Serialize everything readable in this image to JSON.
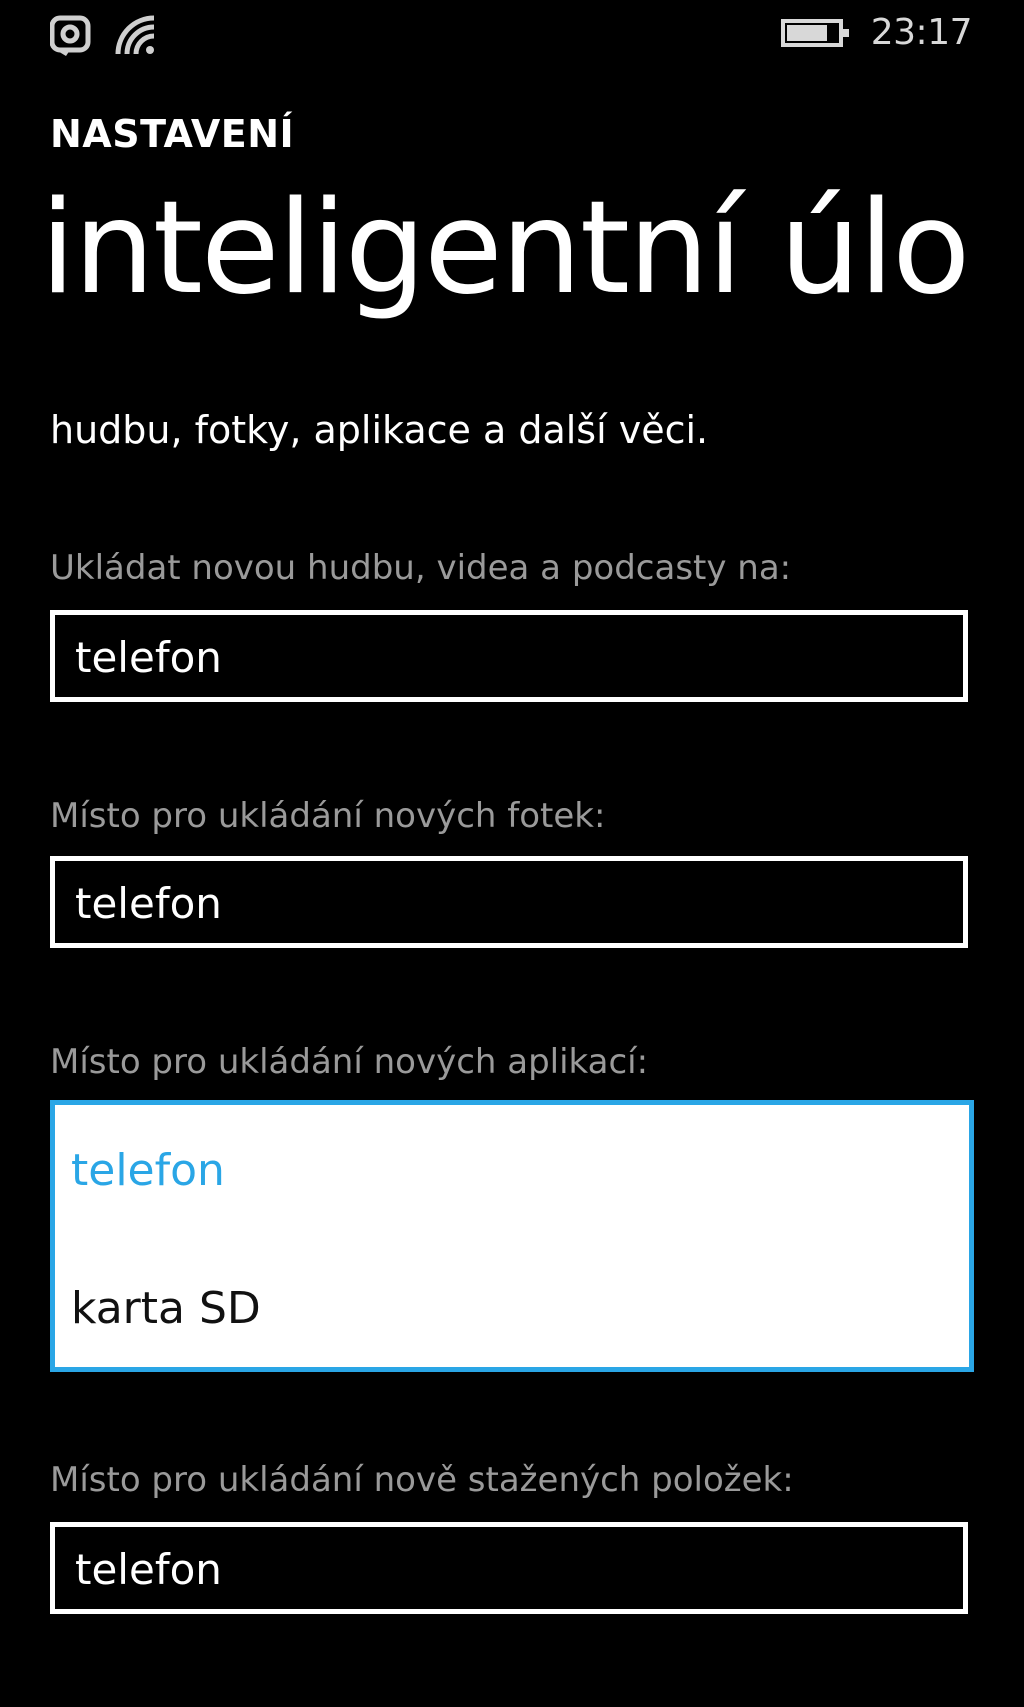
{
  "status_bar": {
    "left_icons": [
      "notification-icon",
      "wifi-icon"
    ],
    "battery_icon": "battery-icon",
    "time": "23:17"
  },
  "header": {
    "section": "NASTAVENÍ",
    "title": "inteligentní úlo"
  },
  "description": "hudbu, fotky, aplikace a další věci.",
  "settings": [
    {
      "label": "Ukládat novou hudbu, videa a podcasty na:",
      "value": "telefon"
    },
    {
      "label": "Místo pro ukládání nových fotek:",
      "value": "telefon"
    },
    {
      "label": "Místo pro ukládání nových aplikací:",
      "options": [
        "telefon",
        "karta SD"
      ],
      "selected": "telefon"
    },
    {
      "label": "Místo pro ukládání nově stažených položek:",
      "value": "telefon"
    }
  ],
  "colors": {
    "background": "#000000",
    "accent": "#2aa6e6",
    "label": "#9a9a9a"
  }
}
